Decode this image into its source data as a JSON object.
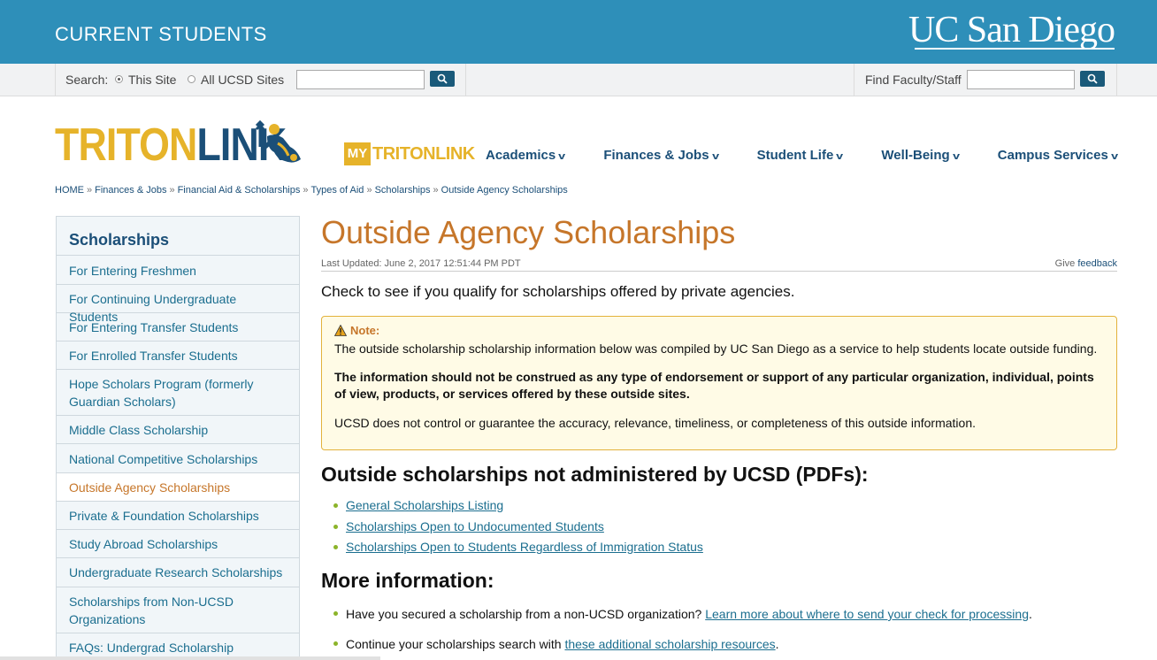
{
  "header": {
    "site_title": "CURRENT STUDENTS",
    "logo_text": "UC San Diego"
  },
  "search": {
    "label": "Search:",
    "option_this_site": "This Site",
    "option_all_sites": "All UCSD Sites",
    "selected_option": "This Site",
    "query_value": "",
    "faculty_label": "Find Faculty/Staff",
    "faculty_value": ""
  },
  "brand": {
    "triton_part1": "TRITON",
    "triton_part2": "LINK",
    "my_part": "MY",
    "my_rest": "TRITONLINK"
  },
  "nav": {
    "items": [
      {
        "label": "Academics"
      },
      {
        "label": "Finances & Jobs"
      },
      {
        "label": "Student Life"
      },
      {
        "label": "Well-Being"
      },
      {
        "label": "Campus Services"
      }
    ]
  },
  "breadcrumb": {
    "items": [
      "HOME",
      "Finances & Jobs",
      "Financial Aid & Scholarships",
      "Types of Aid",
      "Scholarships"
    ],
    "current": "Outside Agency Scholarships",
    "separator": "»"
  },
  "sidebar": {
    "title": "Scholarships",
    "items": [
      {
        "label": "For Entering Freshmen"
      },
      {
        "label": "For Continuing Undergraduate Students"
      },
      {
        "label": "For Entering Transfer Students"
      },
      {
        "label": "For Enrolled Transfer Students"
      },
      {
        "label": "Hope Scholars Program (formerly Guardian Scholars)"
      },
      {
        "label": "Middle Class Scholarship"
      },
      {
        "label": "National Competitive Scholarships"
      },
      {
        "label": "Outside Agency Scholarships"
      },
      {
        "label": "Private & Foundation Scholarships"
      },
      {
        "label": "Study Abroad Scholarships"
      },
      {
        "label": "Undergraduate Research Scholarships"
      },
      {
        "label": "Scholarships from Non-UCSD Organizations"
      },
      {
        "label": "FAQs: Undergrad Scholarship"
      }
    ],
    "active_label": "Outside Agency Scholarships"
  },
  "main": {
    "title": "Outside Agency Scholarships",
    "last_updated": "Last Updated: June 2, 2017 12:51:44 PM PDT",
    "feedback_prefix": "Give",
    "feedback_link": "feedback",
    "intro": "Check to see if you qualify for scholarships offered by private agencies.",
    "note": {
      "heading": "Note:",
      "p1": "The outside scholarship scholarship information below was compiled by UC San Diego as a service to help students locate outside funding.",
      "p2": "The information should not be construed as any type of endorsement or support of any particular organization, individual, points of view, products, or services offered by these outside sites.",
      "p3": "UCSD does not control or guarantee the accuracy, relevance, timeliness, or completeness of this outside information."
    },
    "section1_heading": "Outside scholarships not administered by UCSD (PDFs):",
    "pdf_links": [
      "General Scholarships Listing",
      "Scholarships Open to Undocumented Students",
      "Scholarships Open to Students Regardless of Immigration Status"
    ],
    "section2_heading": "More information:",
    "more_items": [
      {
        "text": "Have you secured a scholarship from a non-UCSD organization?",
        "link": "Learn more about where to send your check for processing",
        "suffix": "."
      },
      {
        "text": "Continue your scholarships search with",
        "link": "these additional scholarship resources",
        "suffix": "."
      }
    ]
  },
  "colors": {
    "banner": "#2e8fb9",
    "brand_gold": "#e6b32a",
    "brand_navy": "#1b4f78",
    "title_orange": "#c6762a",
    "link_blue": "#1b6e8f",
    "note_bg": "#fffbe6",
    "note_border": "#e3b23c",
    "bullet_green": "#8cb42a"
  },
  "icons": [
    "search-icon",
    "warning-icon",
    "chevron-down-icon",
    "triton-mascot-icon"
  ]
}
